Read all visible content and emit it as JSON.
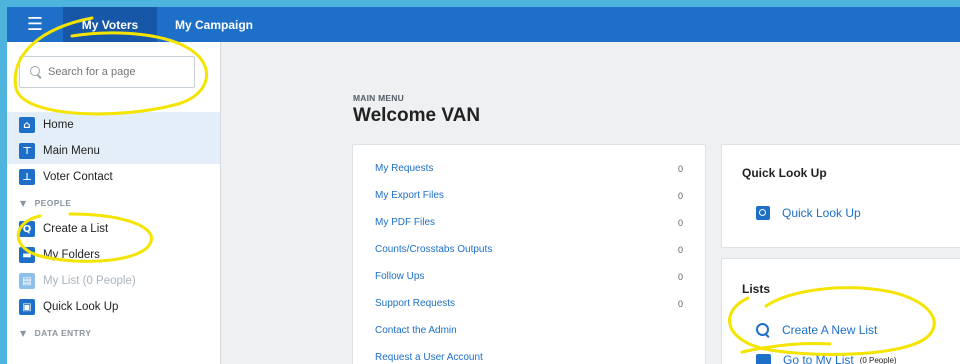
{
  "topbar": {
    "menu_icon": "hamburger-icon",
    "tabs": [
      {
        "label": "My Voters",
        "active": true
      },
      {
        "label": "My Campaign",
        "active": false
      }
    ],
    "color": "#1e6fc8"
  },
  "sidebar": {
    "search_placeholder": "Search for a page",
    "items": [
      {
        "label": "Home",
        "icon": "home-icon"
      },
      {
        "label": "Main Menu",
        "icon": "menu-tree-icon"
      },
      {
        "label": "Voter Contact",
        "icon": "voter-contact-icon"
      }
    ],
    "people_section": "PEOPLE",
    "people_items": [
      {
        "label": "Create a List",
        "icon": "search-list-icon"
      },
      {
        "label": "My Folders",
        "icon": "folder-icon"
      },
      {
        "label": "My List (0 People)",
        "icon": "list-icon",
        "disabled": true
      },
      {
        "label": "Quick Look Up",
        "icon": "quick-lookup-icon"
      }
    ],
    "data_entry_section": "DATA ENTRY"
  },
  "main": {
    "breadcrumb": "MAIN MENU",
    "title": "Welcome VAN",
    "requests": [
      {
        "label": "My Requests",
        "count": "0"
      },
      {
        "label": "My Export Files",
        "count": "0"
      },
      {
        "label": "My PDF Files",
        "count": "0"
      },
      {
        "label": "Counts/Crosstabs Outputs",
        "count": "0"
      },
      {
        "label": "Follow Ups",
        "count": "0"
      },
      {
        "label": "Support Requests",
        "count": "0"
      },
      {
        "label": "Contact the Admin",
        "count": ""
      },
      {
        "label": "Request a User Account",
        "count": ""
      }
    ],
    "quick_lookup": {
      "title": "Quick Look Up",
      "action": "Quick Look Up"
    },
    "lists": {
      "title": "Lists",
      "create": "Create A New List",
      "goto": "Go to My List",
      "goto_count": "(0 People)"
    }
  },
  "annotation_color": "#f5e400"
}
